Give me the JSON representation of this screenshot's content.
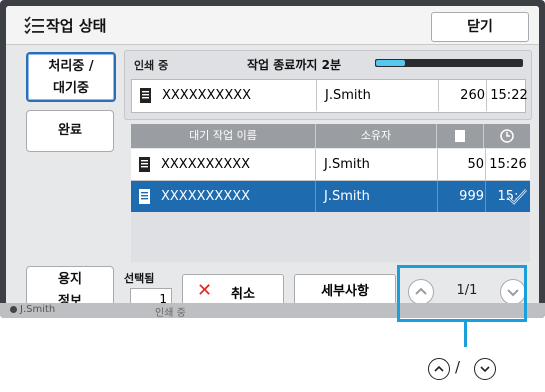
{
  "header": {
    "title": "작업 상태",
    "close_label": "닫기"
  },
  "nav": {
    "processing_line1": "처리중 /",
    "processing_line2": "대기중",
    "done": "완료",
    "info_line1": "용지",
    "info_line2": "정보"
  },
  "printing": {
    "label": "인쇄 중",
    "remaining": "작업 종료까지 2분",
    "progress": 0.2,
    "job": {
      "name": "XXXXXXXXXX",
      "owner": "J.Smith",
      "pages": "260",
      "time": "15:22"
    }
  },
  "queue": {
    "headers": {
      "name": "대기 작업 이름",
      "owner": "소유자"
    },
    "rows": [
      {
        "name": "XXXXXXXXXX",
        "owner": "J.Smith",
        "pages": "50",
        "time": "15:26",
        "selected": false
      },
      {
        "name": "XXXXXXXXXX",
        "owner": "J.Smith",
        "pages": "999",
        "time": "15:",
        "selected": true
      }
    ]
  },
  "bottom": {
    "selected_label": "선택됨",
    "selected_count": "1",
    "cancel_label": "취소",
    "details_label": "세부사항",
    "page_indicator": "1/1"
  },
  "status_strip": {
    "user": "J.Smith",
    "status": "인쇄 중"
  },
  "callout": {
    "separator": "/"
  },
  "colors": {
    "accent": "#1f6bb0",
    "callout": "#1aa0d8",
    "cancel": "#d92b2b",
    "progress": "#55c8ee"
  },
  "icons": [
    "list-check-icon",
    "document-icon",
    "page-icon",
    "clock-icon",
    "check-icon",
    "close-icon",
    "chevron-up-icon",
    "chevron-down-icon",
    "user-icon"
  ]
}
